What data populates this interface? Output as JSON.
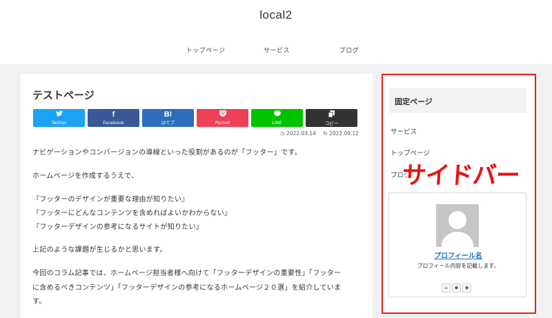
{
  "header": {
    "site_title": "local2",
    "nav": [
      "トップページ",
      "サービス",
      "ブログ"
    ]
  },
  "article": {
    "title": "テストページ",
    "share_buttons": [
      {
        "icon": "twitter-icon",
        "glyph": "🐦",
        "label": "Twitter",
        "color": "#1da1f2"
      },
      {
        "icon": "facebook-icon",
        "glyph": "f",
        "label": "Facebook",
        "color": "#3b5998"
      },
      {
        "icon": "hatena-icon",
        "glyph": "B!",
        "label": "はてブ",
        "color": "#2c6ebd"
      },
      {
        "icon": "pocket-icon",
        "glyph": "✓",
        "label": "Pocket",
        "color": "#ee4056"
      },
      {
        "icon": "line-icon",
        "glyph": "●",
        "label": "LINE",
        "color": "#00c300"
      },
      {
        "icon": "copy-icon",
        "glyph": "⧉",
        "label": "コピー",
        "color": "#333333"
      }
    ],
    "published": "2022.03.14",
    "updated": "2022.09.12",
    "paragraphs": [
      "ナビゲーションやコンバージョンの導線といった役割があるのが「フッター」です。",
      "ホームページを作成するうえで、",
      "『フッターのデザインが重要な理由が知りたい』",
      "『フッターにどんなコンテンツを含めればよいかわからない』",
      "『フッターデザインの参考になるサイトが知りたい』",
      "上記のような課題が生じるかと思います。",
      "今回のコラム記事では、ホームページ担当者様へ向けて「フッターデザインの重要性」「フッター",
      "に含めるべきコンテンツ」「フッターデザインの参考になるホームページ２０選」を紹介していま",
      "す。"
    ]
  },
  "sidebar": {
    "widget_title": "固定ページ",
    "links": [
      "サービス",
      "トップページ",
      "ブログ"
    ],
    "overlay_text": "サイドバー",
    "profile": {
      "name": "プロフィール名",
      "description": "プロフィール内容を記載します。",
      "icons": [
        "home-icon",
        "feedly-icon",
        "rss-icon"
      ]
    }
  },
  "colors": {
    "accent_red": "#e02020",
    "profile_link": "#1e6fc4"
  }
}
